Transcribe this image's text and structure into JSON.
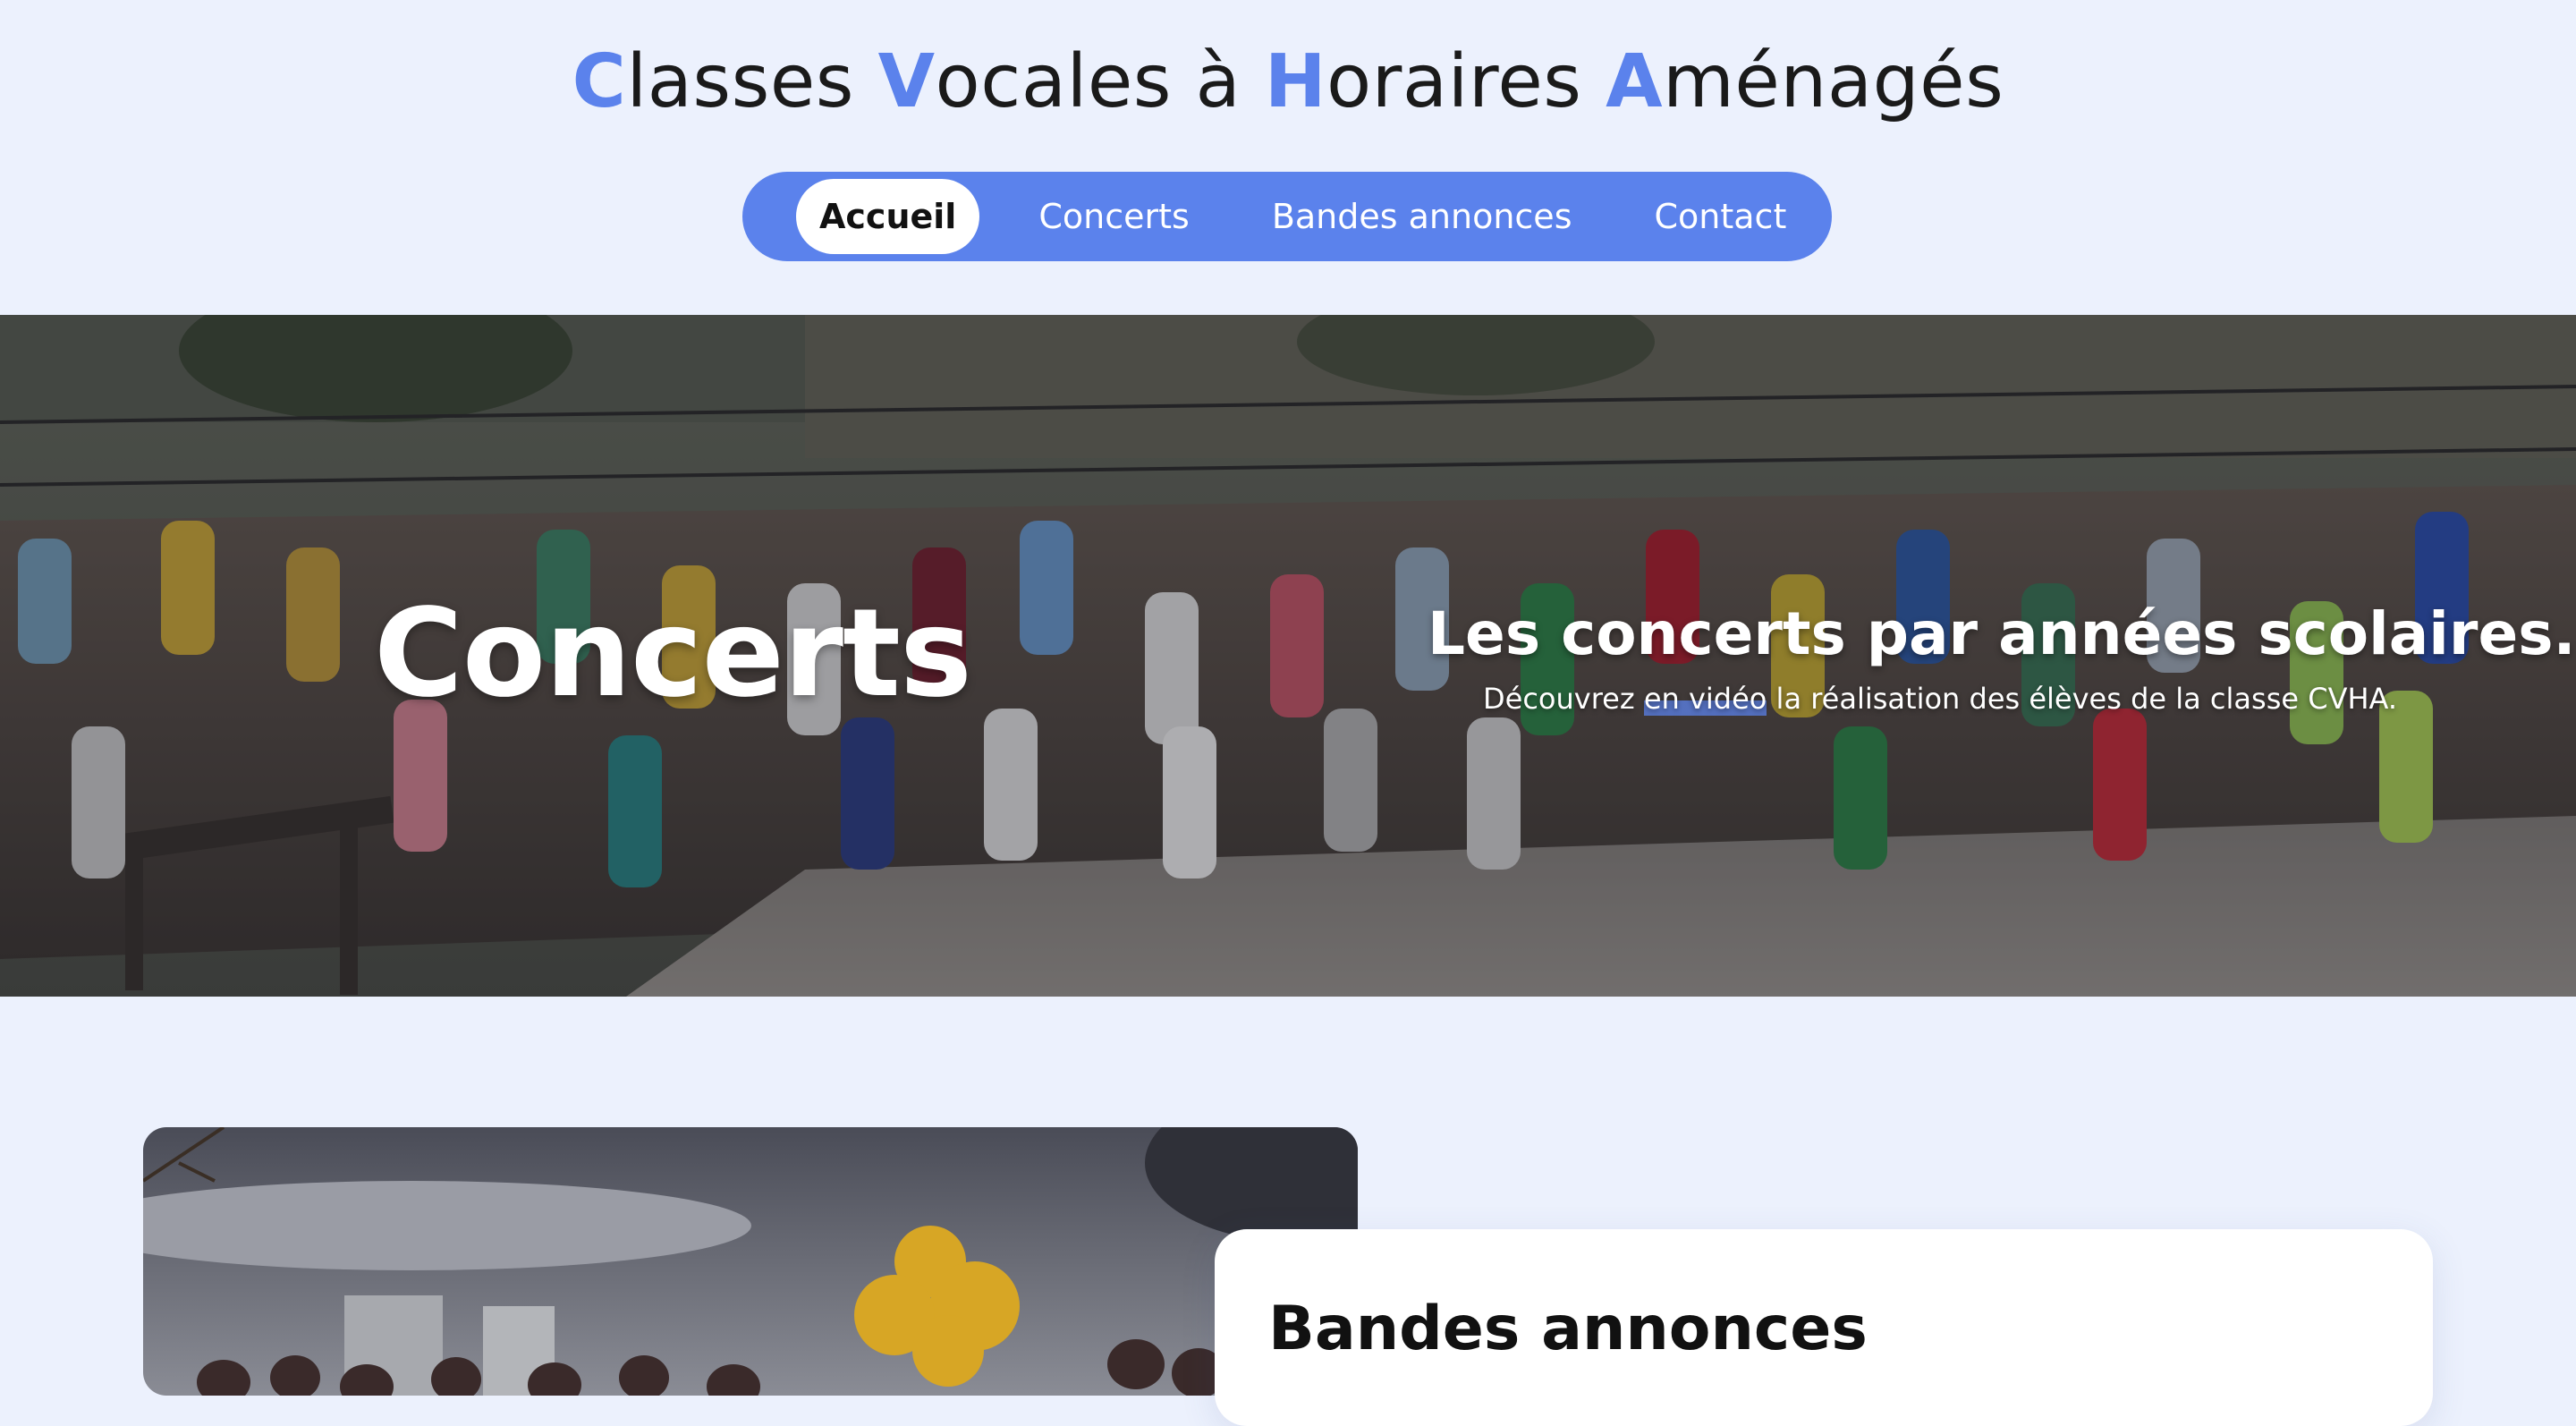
{
  "header": {
    "title_parts": [
      {
        "initial": "C",
        "rest": "lasses "
      },
      {
        "initial": "V",
        "rest": "ocales à "
      },
      {
        "initial": "H",
        "rest": "oraires "
      },
      {
        "initial": "A",
        "rest": "ménagés"
      }
    ]
  },
  "nav": {
    "items": [
      {
        "label": "Accueil",
        "active": true
      },
      {
        "label": "Concerts",
        "active": false
      },
      {
        "label": "Bandes annonces",
        "active": false
      },
      {
        "label": "Contact",
        "active": false
      }
    ]
  },
  "hero": {
    "title": "Concerts",
    "heading": "Les concerts par années scolaires.",
    "subtitle_before": "Découvrez ",
    "subtitle_highlight": "en vidéo",
    "subtitle_after": " la réalisation des élèves de la classe CVHA."
  },
  "section": {
    "card_title": "Bandes annonces"
  },
  "colors": {
    "accent": "#5b82ec",
    "background": "#ecf1fd"
  }
}
